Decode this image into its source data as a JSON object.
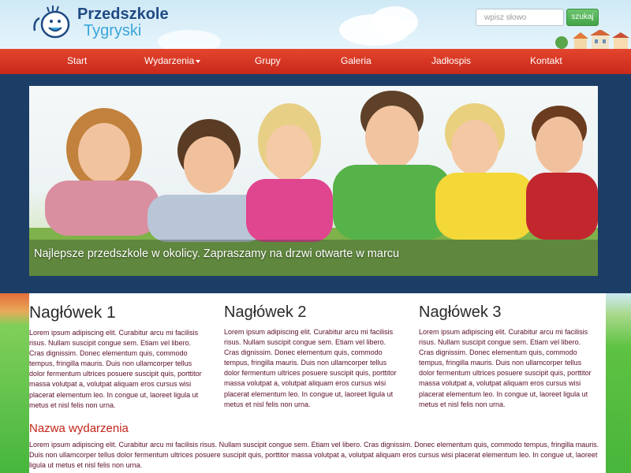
{
  "header": {
    "logo_line1": "Przedszkole",
    "logo_line2": "Tygryski",
    "search_placeholder": "wpisz słowo",
    "search_button": "szukaj"
  },
  "nav": {
    "items": [
      {
        "label": "Start"
      },
      {
        "label": "Wydarzenia",
        "has_dropdown": true
      },
      {
        "label": "Grupy"
      },
      {
        "label": "Galeria"
      },
      {
        "label": "Jadłospis"
      },
      {
        "label": "Kontakt"
      }
    ]
  },
  "hero": {
    "caption": "Najlepsze przedszkole w okolicy. Zapraszamy na drzwi otwarte w marcu"
  },
  "columns": [
    {
      "heading": "Nagłówek 1",
      "text": "Lorem ipsum adipiscing elit. Curabitur arcu mi facilisis risus. Nullam suscipit congue sem. Etiam vel libero. Cras dignissim. Donec elementum quis, commodo tempus, fringilla mauris. Duis non ullamcorper tellus dolor fermentum ultrices posuere suscipit quis, porttitor massa volutpat a, volutpat aliquam eros cursus wisi placerat elementum leo. In congue ut, laoreet ligula ut metus et nisl felis non urna."
    },
    {
      "heading": "Nagłówek 2",
      "text": "Lorem ipsum adipiscing elit. Curabitur arcu mi facilisis risus. Nullam suscipit congue sem. Etiam vel libero. Cras dignissim. Donec elementum quis, commodo tempus, fringilla mauris. Duis non ullamcorper tellus dolor fermentum ultrices posuere suscipit quis, porttitor massa volutpat a, volutpat aliquam eros cursus wisi placerat elementum leo. In congue ut, laoreet ligula ut metus et nisl felis non urna."
    },
    {
      "heading": "Nagłówek 3",
      "text": "Lorem ipsum adipiscing elit. Curabitur arcu mi facilisis risus. Nullam suscipit congue sem. Etiam vel libero. Cras dignissim. Donec elementum quis, commodo tempus, fringilla mauris. Duis non ullamcorper tellus dolor fermentum ultrices posuere suscipit quis, porttitor massa volutpat a, volutpat aliquam eros cursus wisi placerat elementum leo. In congue ut, laoreet ligula ut metus et nisl felis non urna."
    }
  ],
  "event": {
    "title": "Nazwa wydarzenia",
    "text": "Lorem ipsum adipiscing elit. Curabitur arcu mi facilisis risus. Nullam suscipit congue sem. Etiam vel libero. Cras dignissim. Donec elementum quis, commodo tempus, fringilla mauris. Duis non ullamcorper tellus dolor fermentum ultrices posuere suscipit quis, porttitor massa volutpat a, volutpat aliquam eros cursus wisi placerat elementum leo. In congue ut, laoreet ligula ut metus et nisl felis non urna."
  },
  "colors": {
    "nav_red": "#d83722",
    "hero_band": "#1c3e66",
    "button_green": "#4cae4f",
    "event_title_red": "#c3251a",
    "logo_blue": "#1f4a84"
  }
}
